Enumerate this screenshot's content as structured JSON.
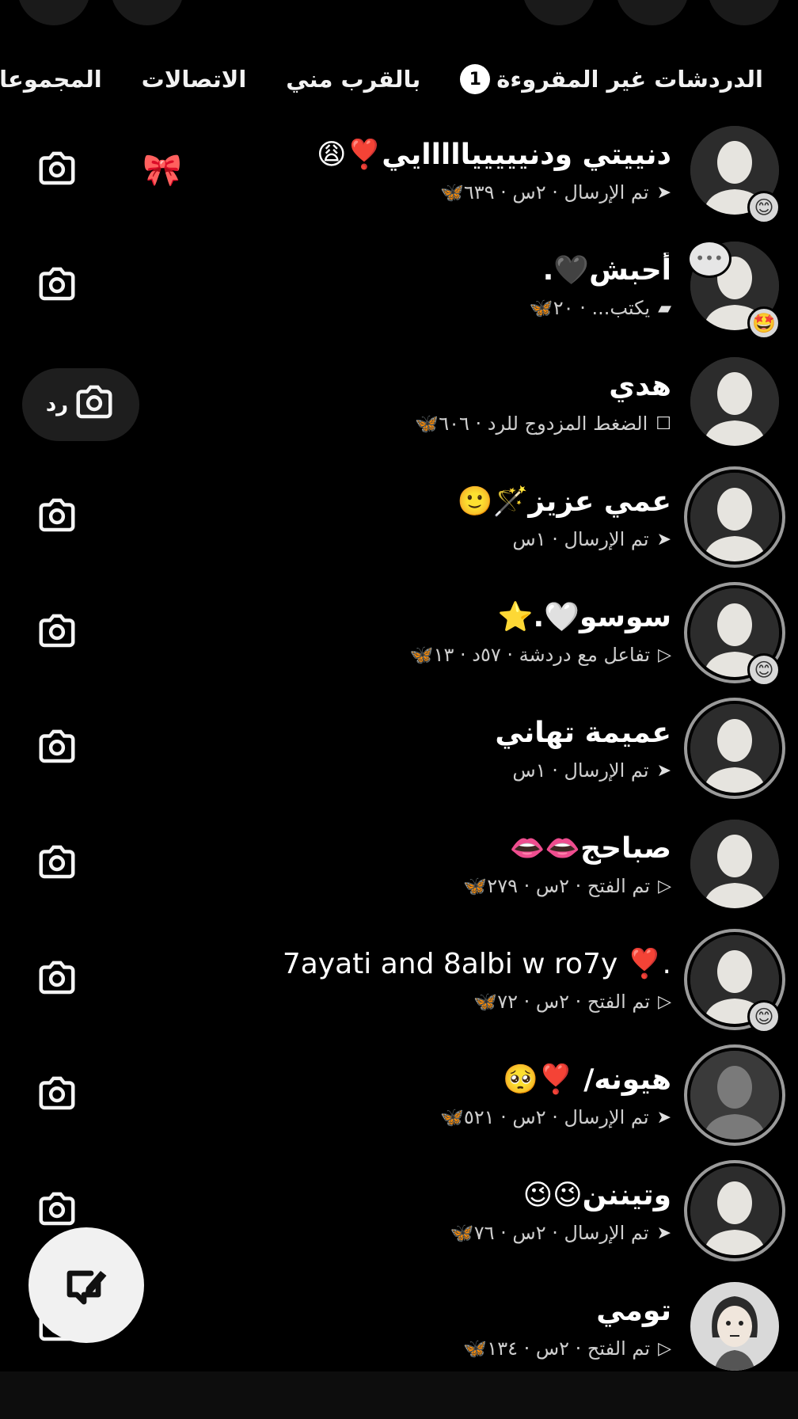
{
  "filters": [
    {
      "label": "الدردشات غير المقروءة",
      "count": "1"
    },
    {
      "label": "بالقرب مني"
    },
    {
      "label": "الاتصالات"
    },
    {
      "label": "المجموعات"
    }
  ],
  "chats": [
    {
      "name": "دنييتي ودنيييييااااايي❣️😩",
      "status_icon": "sent-icon",
      "status": "تم الإرسال · ٢س · ٦٣٩🦋",
      "badge": "😊",
      "extra": "bow-icon",
      "action": "camera"
    },
    {
      "name": "أحبش🖤.",
      "status_icon": "chat-bubble-icon",
      "status": "يكتب... · ٢٠🦋",
      "badge": "🤩",
      "bubble": "•••",
      "action": "camera"
    },
    {
      "name": "هدي",
      "status_icon": "square-icon",
      "status": "الضغط المزدوج للرد · ٦٠٦🦋",
      "action": "reply",
      "reply_label": "رد"
    },
    {
      "name": "عمي عزيز🪄🙂",
      "status_icon": "sent-icon",
      "status": "تم الإرسال · ١س",
      "ring": true,
      "action": "camera"
    },
    {
      "name": "سوسو🤍.⭐",
      "status_icon": "opened-icon",
      "status": "تفاعل مع دردشة · ٥٧د · ١٣🦋",
      "ring": true,
      "badge": "😊",
      "action": "camera"
    },
    {
      "name": "عميمة تهاني",
      "status_icon": "sent-icon",
      "status": "تم الإرسال · ١س",
      "ring": true,
      "action": "camera"
    },
    {
      "name": "صباحج👄👄",
      "status_icon": "opened-icon",
      "status": "تم الفتح · ٢س · ٢٧٩🦋",
      "action": "camera"
    },
    {
      "name": "7ayati and 8albi w ro7y ❣️.",
      "ltr": true,
      "status_icon": "opened-icon",
      "status": "تم الفتح · ٢س · ٧٢🦋",
      "ring": true,
      "badge": "😊",
      "action": "camera"
    },
    {
      "name": "هيونه/ ❣️🥺",
      "status_icon": "sent-icon",
      "status": "تم الإرسال · ٢س · ٥٢١🦋",
      "ring": true,
      "dim": true,
      "action": "camera"
    },
    {
      "name": "وتيننن😉😉",
      "status_icon": "sent-icon",
      "status": "تم الإرسال · ٢س · ٧٦🦋",
      "ring": true,
      "action": "camera"
    },
    {
      "name": "تومي",
      "status_icon": "opened-icon",
      "status": "تم الفتح · ٢س · ١٣٤🦋",
      "bitmoji": true,
      "action": "camera"
    }
  ]
}
